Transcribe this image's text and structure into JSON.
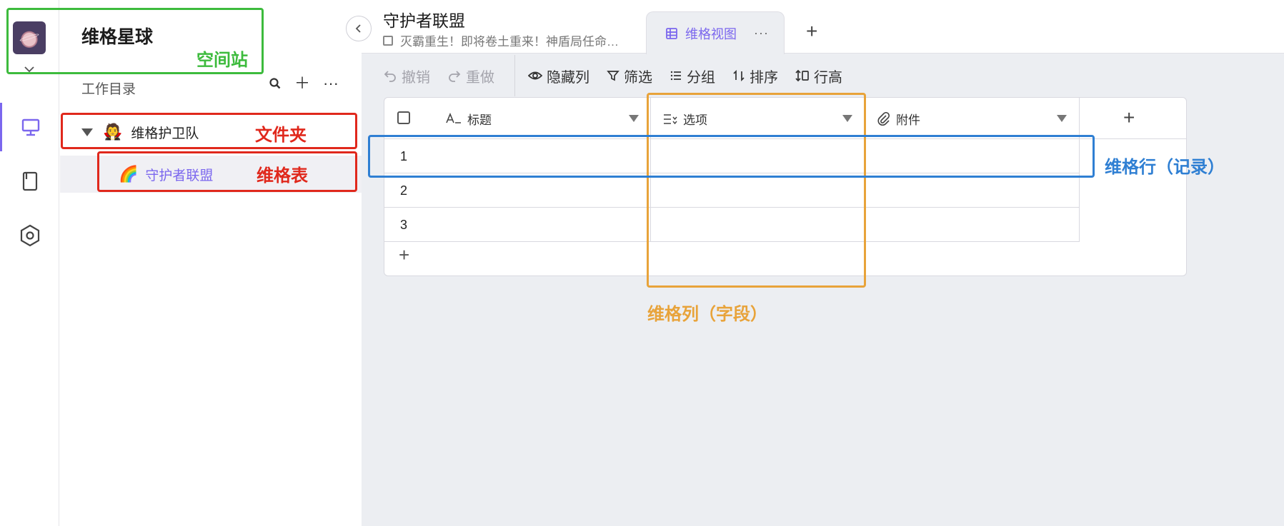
{
  "sidebar": {
    "space_name": "维格星球",
    "directory_title": "工作目录",
    "folder": {
      "emoji": "🧛",
      "label": "维格护卫队"
    },
    "sheet": {
      "emoji": "🌈",
      "label": "守护者联盟"
    }
  },
  "header": {
    "title": "守护者联盟",
    "description": "灭霸重生！即将卷土重来！神盾局任命…",
    "view_tab": "维格视图",
    "view_more": "···",
    "add_view": "+"
  },
  "toolbar": {
    "undo": "撤销",
    "redo": "重做",
    "hide_columns": "隐藏列",
    "filter": "筛选",
    "group": "分组",
    "sort": "排序",
    "row_height": "行高"
  },
  "grid": {
    "columns": [
      "标题",
      "选项",
      "附件"
    ],
    "add_column": "+",
    "rows": [
      "1",
      "2",
      "3"
    ],
    "add_row": "+"
  },
  "annotations": {
    "space_station": "空间站",
    "folder": "文件夹",
    "sheet": "维格表",
    "column": "维格列（字段）",
    "row": "维格行（记录）"
  },
  "colors": {
    "accent": "#7b67ee",
    "annotation_green": "#3dbb3d",
    "annotation_red": "#e0281c",
    "annotation_orange": "#e8a33a",
    "annotation_blue": "#2f7fd3"
  }
}
